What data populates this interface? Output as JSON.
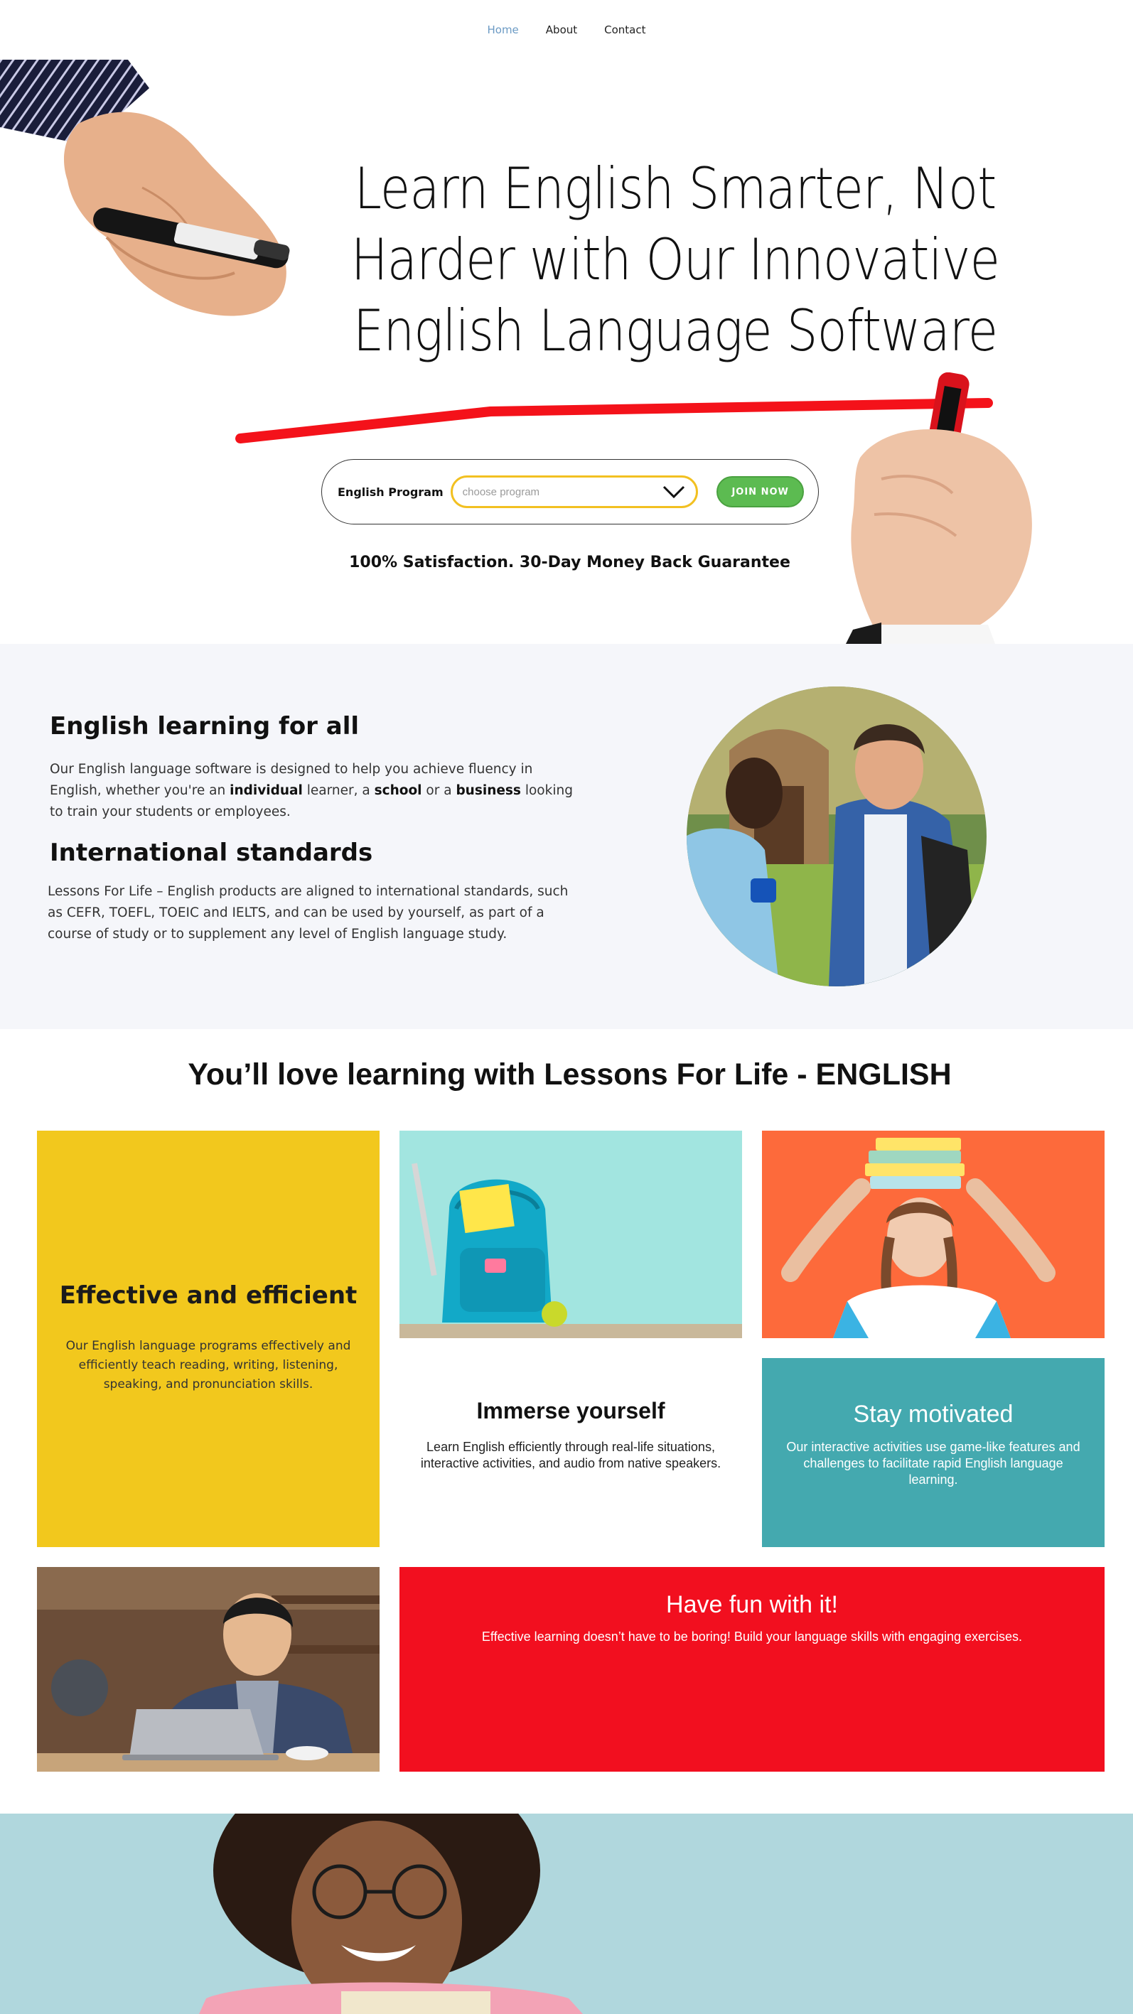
{
  "nav": {
    "items": [
      {
        "label": "Home",
        "active": true
      },
      {
        "label": "About",
        "active": false
      },
      {
        "label": "Contact",
        "active": false
      }
    ]
  },
  "hero": {
    "title": "Learn English Smarter, Not Harder with Our Innovative English Language Software",
    "form_label": "English Program",
    "select_placeholder": "choose program",
    "join_button": "JOIN NOW",
    "guarantee": "100% Satisfaction. 30-Day Money Back Guarantee"
  },
  "intro": {
    "heading1": "English learning for all",
    "para1_a": "Our English language software is designed to help you achieve fluency in English, whether you're an ",
    "para1_b1": "individual",
    "para1_c": " learner, a ",
    "para1_b2": "school",
    "para1_d": " or a ",
    "para1_b3": "business",
    "para1_e": " looking to train your students or employees.",
    "heading2": "International standards",
    "para2": "Lessons For Life – English products are aligned to international standards, such as CEFR, TOEFL, TOEIC and IELTS, and can be used by yourself, as part of a course of study or to supplement any level of English language study."
  },
  "features": {
    "title": "You’ll love learning with Lessons For Life - ENGLISH",
    "effective": {
      "title": "Effective and efficient",
      "text": "Our English language programs effectively and efficiently teach reading, writing, listening, speaking, and pronunciation skills."
    },
    "immerse": {
      "title": "Immerse yourself",
      "text": "Learn English efficiently through real-life situations, interactive activities, and audio from native speakers."
    },
    "motivated": {
      "title": "Stay motivated",
      "text": "Our interactive activities use game-like features and challenges to facilitate rapid English language learning."
    },
    "fun": {
      "title": "Have fun with it!",
      "text": "Effective learning doesn’t have to be boring! Build your language skills with engaging exercises."
    }
  },
  "colors": {
    "accent_yellow": "#f2c81d",
    "accent_green": "#5cbb51",
    "accent_teal": "#44a9af",
    "accent_red": "#f20f1f",
    "accent_orange": "#fd6a3b",
    "nav_active": "#6b9ac4"
  },
  "icons": {
    "select_chevron": "chevron-down-icon"
  }
}
